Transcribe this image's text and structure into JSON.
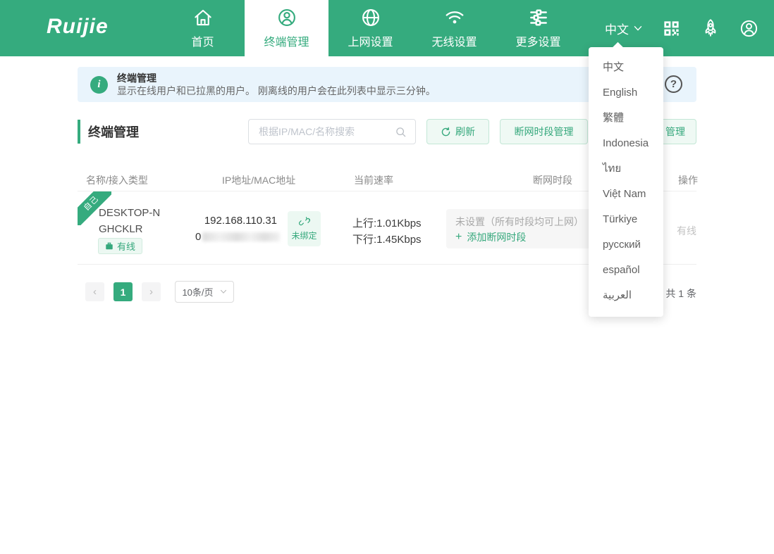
{
  "navbar": {
    "brand": "Ruijie",
    "items": [
      {
        "label": "首页",
        "icon": "home-icon"
      },
      {
        "label": "终端管理",
        "icon": "user-circle-icon",
        "active": true
      },
      {
        "label": "上网设置",
        "icon": "globe-icon"
      },
      {
        "label": "无线设置",
        "icon": "wifi-icon"
      },
      {
        "label": "更多设置",
        "icon": "sliders-icon"
      }
    ],
    "language_current": "中文"
  },
  "lang_menu": {
    "items": [
      "中文",
      "English",
      "繁體",
      "Indonesia",
      "ไทย",
      "Việt Nam",
      "Türkiye",
      "русский",
      "español",
      "العربية"
    ]
  },
  "banner": {
    "title": "终端管理",
    "description": "显示在线用户和已拉黑的用户。 刚离线的用户会在此列表中显示三分钟。"
  },
  "icons": {
    "info_glyph": "i",
    "help_glyph": "?"
  },
  "toolbar": {
    "section_title": "终端管理",
    "search_placeholder": "根据IP/MAC/名称搜索",
    "refresh_label": "刷新",
    "schedule_manage_label": "断网时段管理",
    "partial_button_label": "管理"
  },
  "table": {
    "columns": [
      "名称/接入类型",
      "IP地址/MAC地址",
      "当前速率",
      "断网时段",
      "操作"
    ],
    "row": {
      "ribbon": "自己",
      "device_name": "DESKTOP-NGHCKLR",
      "access_type": "有线",
      "ip": "192.168.110.31",
      "mac_prefix": "0",
      "mac_blurred": true,
      "bind_status": "未绑定",
      "rate_up": "上行:1.01Kbps",
      "rate_down": "下行:1.45Kbps",
      "schedule_status": "未设置（所有时段均可上网）",
      "schedule_add_plus": "+",
      "schedule_add": "添加断网时段",
      "action": "有线"
    }
  },
  "pagination": {
    "prev": "‹",
    "current_page": "1",
    "next": "›",
    "page_size": "10条/页",
    "total": "共 1 条"
  },
  "colors": {
    "accent_green": "#35ab7e",
    "banner_bg": "#e9f4fc",
    "light_button_bg": "#eff9f4",
    "light_button_border": "#c3e7d6",
    "muted_text": "#a8a8a8"
  }
}
